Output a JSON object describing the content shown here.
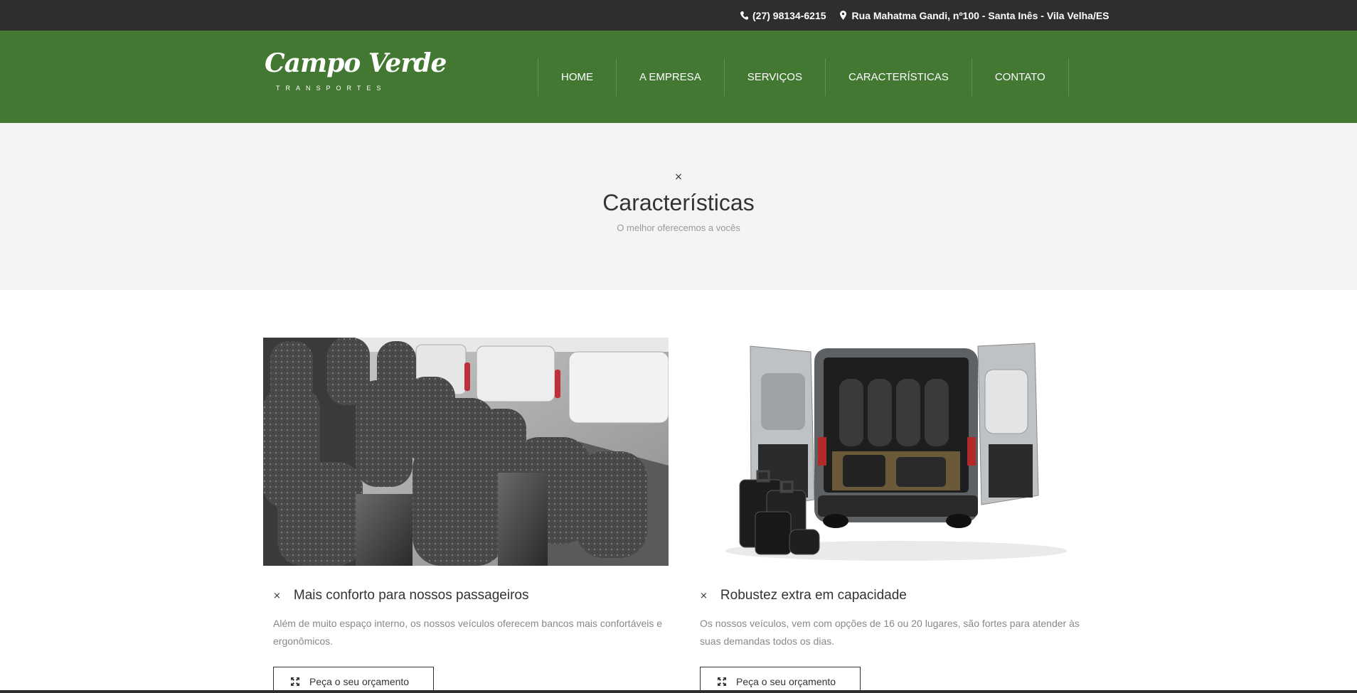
{
  "topbar": {
    "phone": "(27) 98134-6215",
    "phone_icon": "phone-icon",
    "address": "Rua Mahatma Gandi, nº100 - Santa Inês - Vila Velha/ES",
    "address_icon": "map-marker-icon"
  },
  "header": {
    "logo_name": "Campo Verde",
    "logo_sub": "TRANSPORTES",
    "nav": [
      "HOME",
      "A EMPRESA",
      "SERVIÇOS",
      "CARACTERÍSTICAS",
      "CONTATO"
    ],
    "brand_color": "#437833"
  },
  "section": {
    "icon": "×",
    "title": "Características",
    "subtitle": "O melhor oferecemos a vocês"
  },
  "features": [
    {
      "image": "van-interior-seats-photo",
      "icon": "×",
      "title": "Mais conforto para nossos passageiros",
      "description": "Além de muito espaço interno, os nossos veículos oferecem bancos mais confortáveis e ergonômicos.",
      "button_icon": "expand-icon",
      "button_label": "Peça o seu orçamento"
    },
    {
      "image": "van-rear-open-luggage-photo",
      "icon": "×",
      "title": "Robustez extra em capacidade",
      "description": "Os nossos veículos, vem com opções de 16 ou 20 lugares, são fortes para atender às suas demandas todos os dias.",
      "button_icon": "expand-icon",
      "button_label": "Peça o seu orçamento"
    }
  ]
}
